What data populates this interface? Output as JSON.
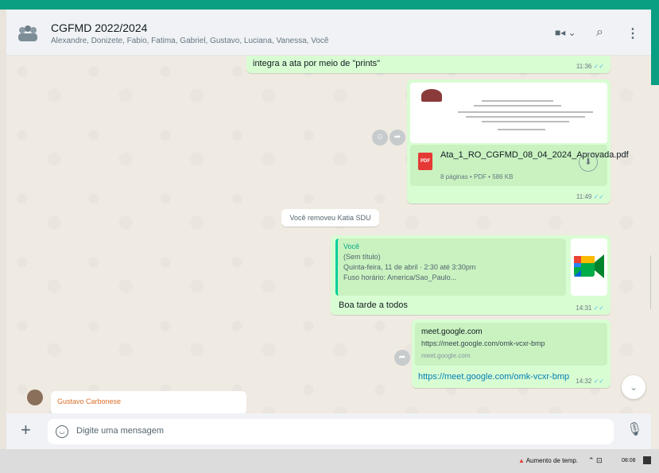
{
  "header": {
    "title": "CGFMD 2022/2024",
    "members": "Alexandre, Donizete, Fabio, Fatima, Gabriel, Gustavo, Luciana, Vanessa, Você"
  },
  "messages": {
    "m1": {
      "text": "integra a ata por meio de \"prints\"",
      "time": "11:36"
    },
    "m2": {
      "file_name": "Ata_1_RO_CGFMD_08_04_2024_Aprovada.pdf",
      "file_meta": "8 páginas • PDF • 586 KB",
      "badge": "PDF",
      "time": "11:49"
    },
    "system": "Você removeu Katia SDU",
    "m3": {
      "quote_author": "Você",
      "quote_line1": "(Sem título)",
      "quote_line2": "Quinta-feira, 11 de abril · 2:30 até 3:30pm",
      "quote_line3": "Fuso horário: America/Sao_Paulo...",
      "text": "Boa tarde a todos",
      "time": "14:31"
    },
    "m4": {
      "link_title": "meet.google.com",
      "link_desc": "https://meet.google.com/omk-vcxr-bmp",
      "link_host": "meet.google.com",
      "url": "https://meet.google.com/omk-vcxr-bmp",
      "time": "14:32"
    },
    "incoming_sender": "Gustavo Carbonese"
  },
  "compose": {
    "placeholder": "Digite uma mensagem"
  },
  "taskbar": {
    "weather": "Aumento de temp.",
    "time": "08:08"
  }
}
